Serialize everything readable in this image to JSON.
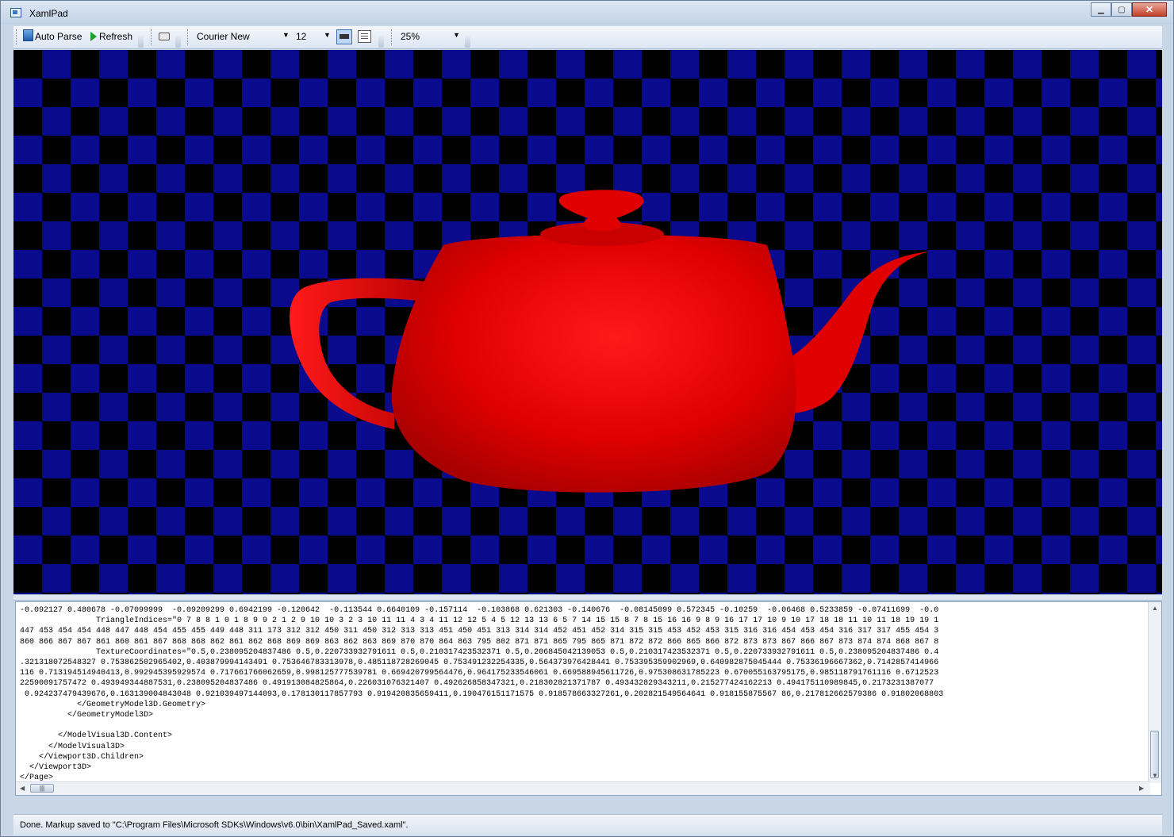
{
  "window": {
    "title": "XamlPad"
  },
  "toolbar": {
    "auto_parse": "Auto Parse",
    "refresh": "Refresh",
    "font_family": "Courier New",
    "font_size": "12",
    "zoom": "25%"
  },
  "viewport": {
    "checker_colors": [
      "#000000",
      "#0a0a8c"
    ],
    "teapot_color": "#e00000"
  },
  "editor": {
    "lines": [
      "-0.092127 0.480678 -0.07099999  -0.09209299 0.6942199 -0.120642  -0.113544 0.6640109 -0.157114  -0.103868 0.621303 -0.140676  -0.08145099 0.572345 -0.10259  -0.06468 0.5233859 -0.07411699  -0.0",
      "                TriangleIndices=\"0 7 8 8 1 0 1 8 9 9 2 1 2 9 10 10 3 2 3 10 11 11 4 3 4 11 12 12 5 4 5 12 13 13 6 5 7 14 15 15 8 7 8 15 16 16 9 8 9 16 17 17 10 9 10 17 18 18 11 10 11 18 19 19 1",
      "447 453 454 454 448 447 448 454 455 455 449 448 311 173 312 312 450 311 450 312 313 313 451 450 451 313 314 314 452 451 452 314 315 315 453 452 453 315 316 316 454 453 454 316 317 317 455 454 3",
      "860 866 867 867 861 860 861 867 868 868 862 861 862 868 869 869 863 862 863 869 870 870 864 863 795 802 871 871 865 795 865 871 872 872 866 865 866 872 873 873 867 866 867 873 874 874 868 867 8",
      "                TextureCoordinates=\"0.5,0.238095204837486 0.5,0.220733932791611 0.5,0.210317423532371 0.5,0.206845042139053 0.5,0.210317423532371 0.5,0.220733932791611 0.5,0.238095204837486 0.4",
      ".321318072548327 0.753862502965402,0.403879994143491 0.753646783313978,0.485118728269045 0.753491232254335,0.564373976428441 0.753395359902969,0.640982875045444 0.75336196667362,0.7142857414966",
      "116 0.713194514940413,0.992945395929574 0.717661766062659,0.998125777539781 0.669420799564476,0.964175233546061 0.669588945611726,0.975308631785223 0.670055163795175,0.985118791761116 0.6712523",
      "22590091757472 0.493949344887531,0.238095204837486 0.491913084825864,0.226031076321407 0.492626858347321,0.218302821371787 0.493432829343211,0.215277424162213 0.494175110989845,0.2173231387077",
      " 0.924237479439676,0.163139004843048 0.921039497144093,0.178130117857793 0.919420835659411,0.190476151171575 0.918578663327261,0.202821549564641 0.918155875567 86,0.217812662579386 0.91802068803",
      "            </GeometryModel3D.Geometry>",
      "          </GeometryModel3D>",
      "",
      "        </ModelVisual3D.Content>",
      "      </ModelVisual3D>",
      "    </Viewport3D.Children>",
      "  </Viewport3D>",
      "</Page>",
      "|"
    ]
  },
  "status": {
    "text": "Done. Markup saved to \"C:\\Program Files\\Microsoft SDKs\\Windows\\v6.0\\bin\\XamlPad_Saved.xaml\"."
  }
}
